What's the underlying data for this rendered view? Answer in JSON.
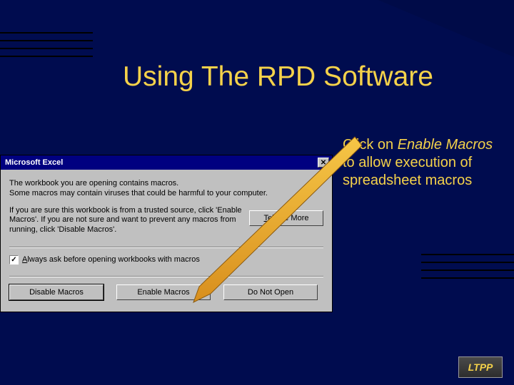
{
  "slide": {
    "title": "Using The RPD Software",
    "caption_prefix": "Click on ",
    "caption_em": "Enable Macros",
    "caption_suffix": " to allow execution of spreadsheet macros",
    "logo": "LTPP"
  },
  "dialog": {
    "title": "Microsoft Excel",
    "p1a": "The workbook you are opening contains macros.",
    "p1b": "Some macros may contain viruses that could be harmful to your computer.",
    "p2": "If you are sure this workbook is from a trusted source, click 'Enable Macros'. If you are not sure and want to prevent any macros from running, click 'Disable Macros'.",
    "tell_more": "Tell Me More",
    "always_ask": "Always ask before opening workbooks with macros",
    "checked": "✓",
    "btn_disable": "Disable Macros",
    "btn_enable": "Enable Macros",
    "btn_noopen": "Do Not Open"
  }
}
